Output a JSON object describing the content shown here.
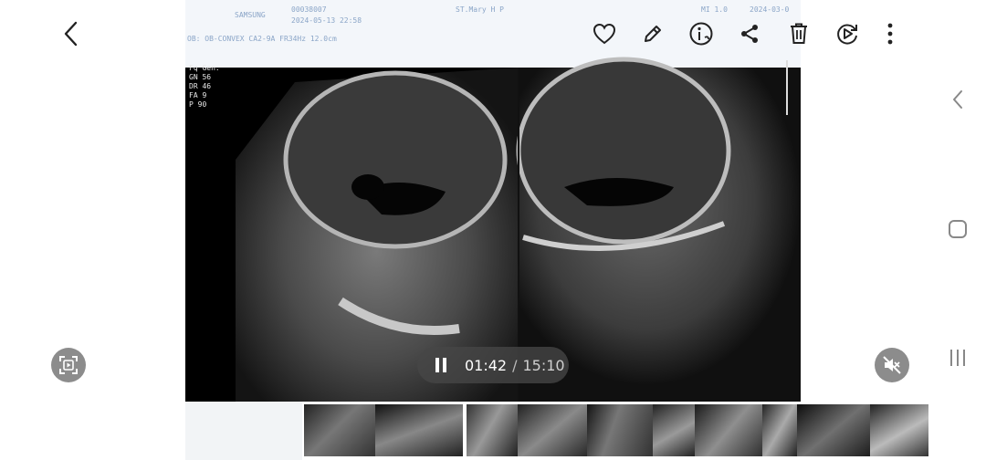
{
  "top_bar": {
    "icons": [
      "back-icon",
      "heart-icon",
      "edit-icon",
      "details-icon",
      "share-icon",
      "delete-icon",
      "rotate-play-icon",
      "more-icon"
    ]
  },
  "video": {
    "header_left": "SAMSUNG",
    "header_id": "00038007",
    "header_date": "2024-05-13 22:58",
    "header_name": "ST.Mary H P",
    "header_mi": "MI 1.0",
    "header_date2": "2024-03-0",
    "header_probe": "OB: OB-CONVEX  CA2-9A  FR34Hz  12.0cm",
    "params": [
      {
        "k": "Fq",
        "v": "Gen."
      },
      {
        "k": "GN",
        "v": "56"
      },
      {
        "k": "DR",
        "v": "46"
      },
      {
        "k": "FA",
        "v": "9"
      },
      {
        "k": "P",
        "v": "90"
      }
    ]
  },
  "playback": {
    "current_time": "01:42",
    "separator": "/",
    "total_time": "15:10",
    "state": "playing"
  },
  "side_controls": {
    "capture_icon": "screen-capture-icon",
    "mute_icon": "sound-off-icon"
  },
  "nav_bar": {
    "icons": [
      "nav-back-icon",
      "nav-home-icon",
      "nav-recents-icon"
    ]
  },
  "filmstrip": {
    "thumb_count": 10
  },
  "colors": {
    "icon": "#222222",
    "nav_icon": "#888888",
    "pill_bg": "#464646",
    "round_btn_bg": "#787878"
  }
}
